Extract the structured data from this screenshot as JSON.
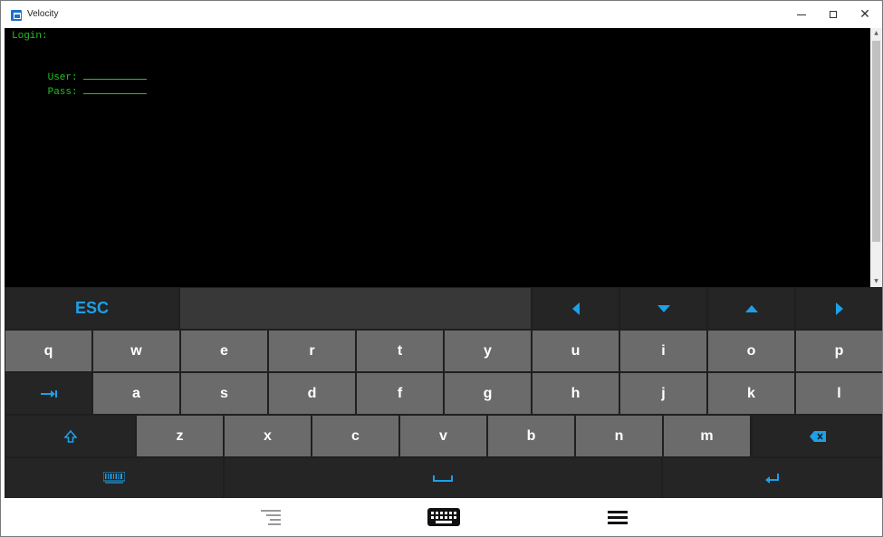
{
  "window": {
    "title": "Velocity",
    "icon": "velocity-app-icon",
    "controls": [
      "minimize-icon",
      "maximize-icon",
      "close-icon"
    ],
    "close_glyph": "✕"
  },
  "terminal": {
    "lines": {
      "login": "Login:",
      "user_label": "User:",
      "pass_label": "Pass:"
    },
    "text_color": "#22c322",
    "background": "#000000"
  },
  "keyboard": {
    "esc_label": "ESC",
    "row1": [
      "q",
      "w",
      "e",
      "r",
      "t",
      "y",
      "u",
      "i",
      "o",
      "p"
    ],
    "row2": [
      "a",
      "s",
      "d",
      "f",
      "g",
      "h",
      "j",
      "k",
      "l"
    ],
    "row3": [
      "z",
      "x",
      "c",
      "v",
      "b",
      "n",
      "m"
    ],
    "icons": {
      "arrow_left": "arrow-left-icon",
      "arrow_down": "arrow-down-icon",
      "arrow_up": "arrow-up-icon",
      "arrow_right": "arrow-right-icon",
      "tab": "tab-icon",
      "shift": "shift-icon",
      "backspace": "backspace-icon",
      "barcode": "barcode-icon",
      "space": "space-icon",
      "enter": "enter-icon"
    },
    "accent_color": "#1ca0e8"
  },
  "bottom_bar": {
    "icons": [
      "text-align-icon",
      "keyboard-icon",
      "menu-icon"
    ]
  }
}
